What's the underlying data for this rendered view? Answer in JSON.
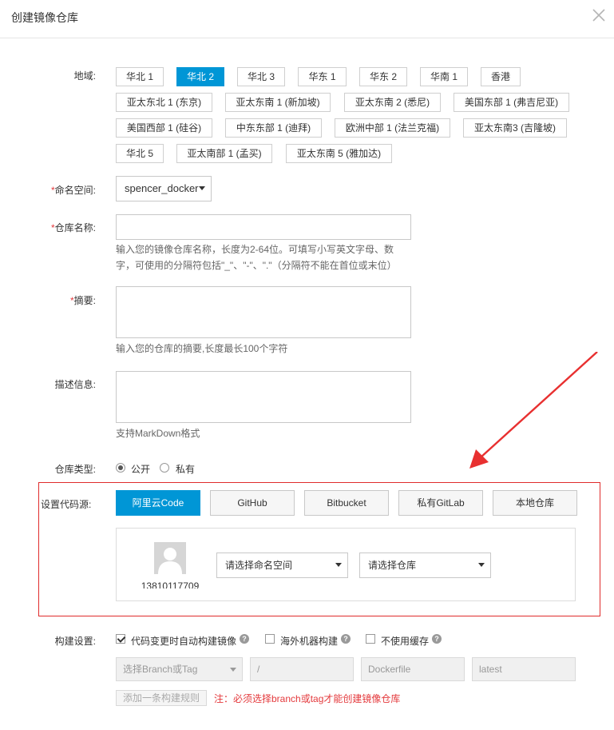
{
  "dialog": {
    "title": "创建镜像仓库"
  },
  "region": {
    "label": "地域:",
    "options": [
      "华北 1",
      "华北 2",
      "华北 3",
      "华东 1",
      "华东 2",
      "华南 1",
      "香港",
      "亚太东北 1 (东京)",
      "亚太东南 1 (新加坡)",
      "亚太东南 2 (悉尼)",
      "美国东部 1 (弗吉尼亚)",
      "美国西部 1 (硅谷)",
      "中东东部 1 (迪拜)",
      "欧洲中部 1 (法兰克福)",
      "亚太东南3 (吉隆坡)",
      "华北 5",
      "亚太南部 1 (孟买)",
      "亚太东南 5 (雅加达)"
    ],
    "selected": "华北 2"
  },
  "namespace": {
    "label": "命名空间:",
    "value": "spencer_docker"
  },
  "repo_name": {
    "label": "仓库名称:",
    "value": "",
    "help_line1": "输入您的镜像仓库名称，长度为2-64位。可填写小写英文字母、数",
    "help_line2": "字，可使用的分隔符包括\"_\"、\"-\"、\".\"（分隔符不能在首位或末位）"
  },
  "summary": {
    "label": "摘要:",
    "value": "",
    "help": "输入您的仓库的摘要,长度最长100个字符"
  },
  "description": {
    "label": "描述信息:",
    "value": "",
    "help": "支持MarkDown格式"
  },
  "repo_type": {
    "label": "仓库类型:",
    "public": "公开",
    "private": "私有",
    "selected": "公开"
  },
  "code_source": {
    "label": "设置代码源:",
    "options": [
      "阿里云Code",
      "GitHub",
      "Bitbucket",
      "私有GitLab",
      "本地仓库"
    ],
    "selected": "阿里云Code",
    "account": "13810117709",
    "namespace_select": "请选择命名空间",
    "repo_select": "请选择仓库"
  },
  "build": {
    "label": "构建设置:",
    "auto_build": "代码变更时自动构建镜像",
    "auto_build_checked": true,
    "overseas": "海外机器构建",
    "overseas_checked": false,
    "no_cache": "不使用缓存",
    "no_cache_checked": false,
    "branch_placeholder": "选择Branch或Tag",
    "dir": "/",
    "dockerfile": "Dockerfile",
    "tag": "latest",
    "add_rule": "添加一条构建规则",
    "note": "注：必须选择branch或tag才能创建镜像仓库"
  },
  "colors": {
    "accent": "#0096d6",
    "error": "#e02c2c"
  }
}
